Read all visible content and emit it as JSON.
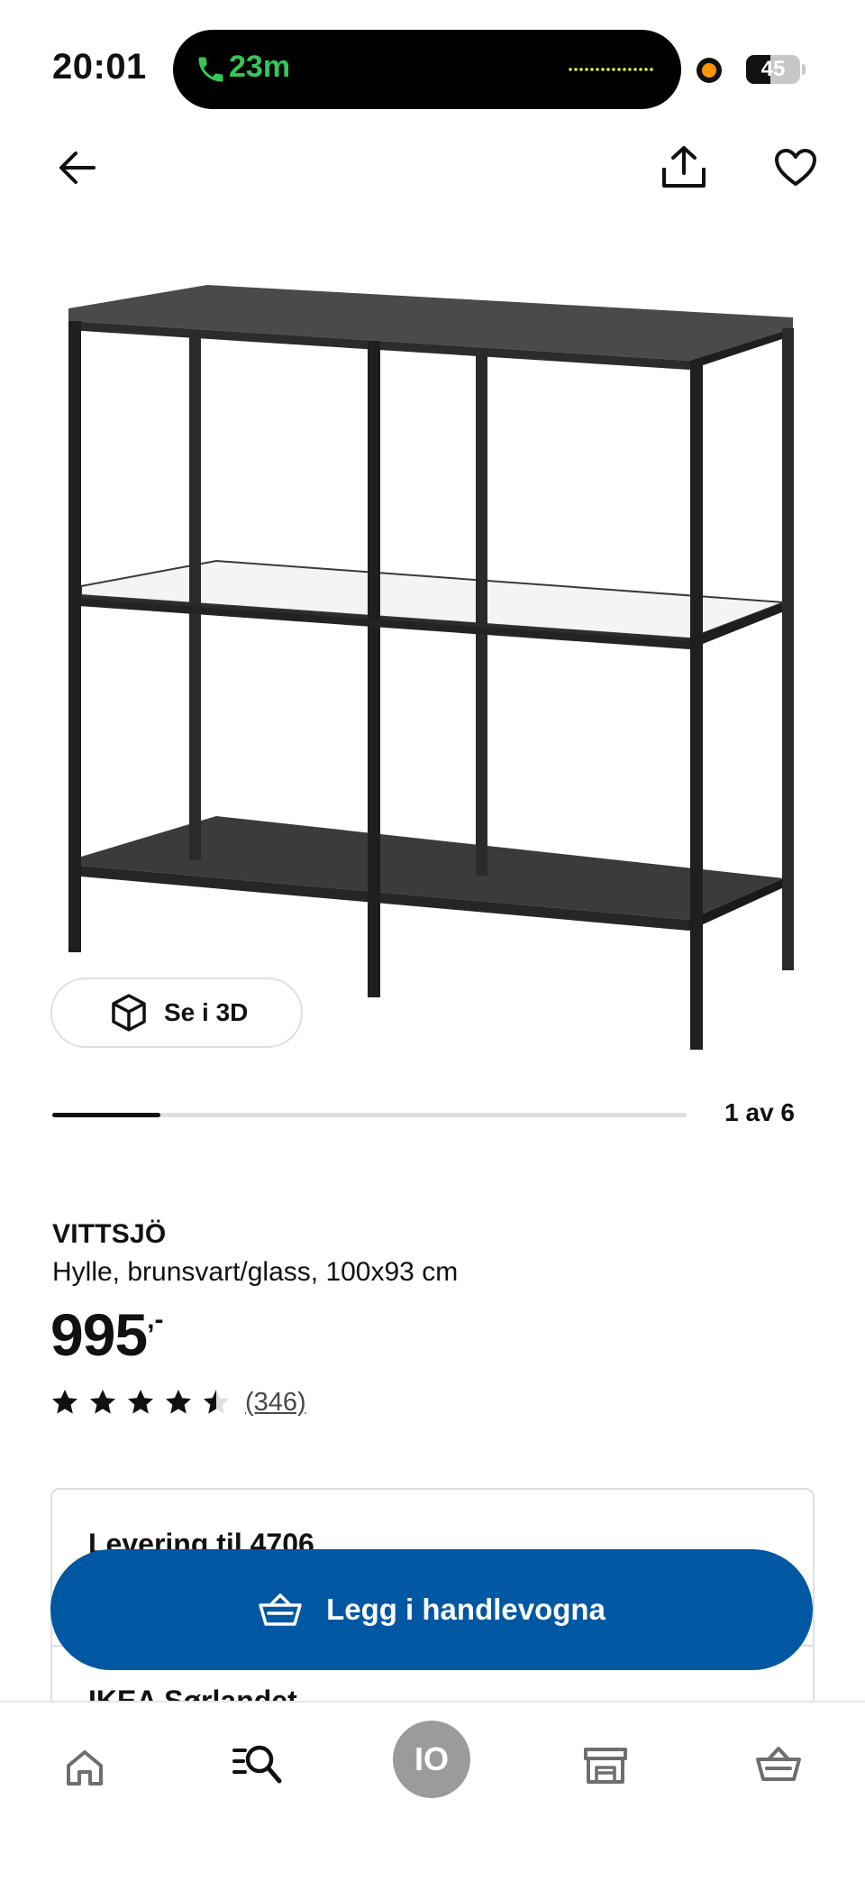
{
  "status_bar": {
    "time": "20:01",
    "call_duration": "23m",
    "battery_percent": 45,
    "battery_label": "45",
    "colors": {
      "call_green": "#34c759",
      "recording_orange": "#ff9500"
    }
  },
  "top_nav": {
    "back_icon": "arrow-left-icon",
    "share_icon": "share-icon",
    "favorite_icon": "heart-icon"
  },
  "gallery": {
    "view_3d_label": "Se i 3D",
    "progress_fraction": 0.17,
    "counter_text": "1 av 6"
  },
  "product": {
    "name": "VITTSJÖ",
    "description": "Hylle, brunsvart/glass, 100x93 cm",
    "price": "995",
    "price_suffix": ",-",
    "rating_value": 4.5,
    "rating_max": 5,
    "review_count": "(346)"
  },
  "availability": {
    "delivery_label": "Levering til 4706",
    "store_label": "IKEA Sørlandet"
  },
  "cta": {
    "add_to_cart_label": "Legg i handlevogna",
    "color": "#0058a3"
  },
  "tab_bar": {
    "avatar_initials": "IO",
    "items": [
      "home-icon",
      "search-icon",
      "avatar",
      "store-icon",
      "basket-icon"
    ]
  }
}
